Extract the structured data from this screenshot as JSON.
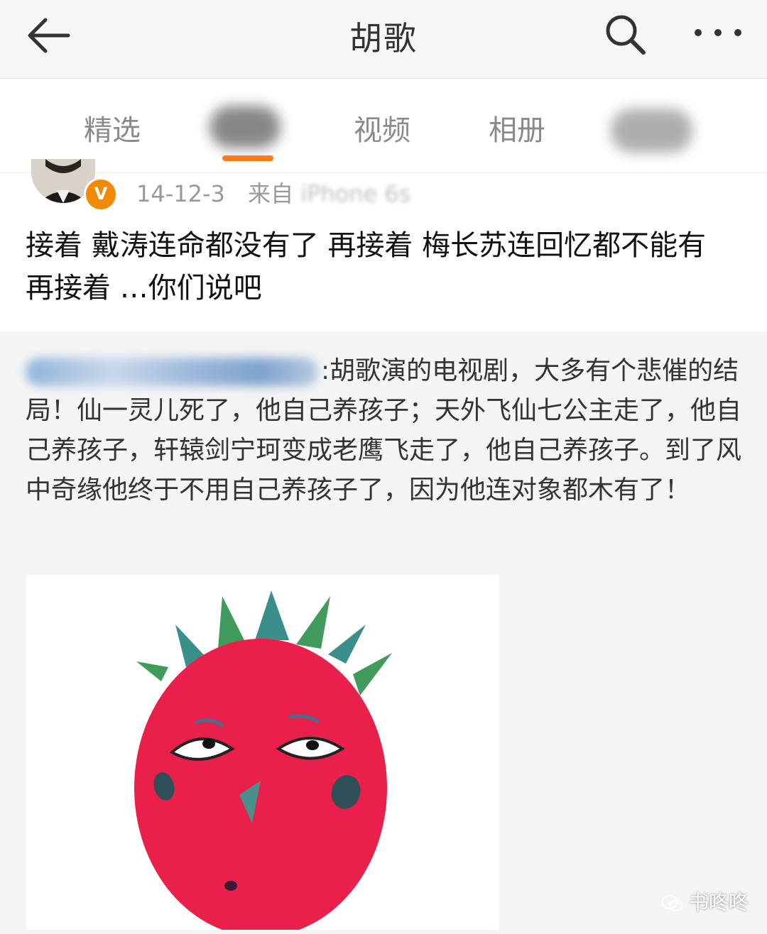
{
  "header": {
    "title": "胡歌",
    "back_icon": "back-arrow-icon",
    "search_icon": "search-icon",
    "more_icon": "more-icon"
  },
  "tabs": [
    {
      "label": "精选",
      "active": false
    },
    {
      "label": "",
      "active": true,
      "note": "blurred"
    },
    {
      "label": "视频",
      "active": false
    },
    {
      "label": "相册",
      "active": false
    },
    {
      "label": "",
      "active": false,
      "note": "blurred"
    }
  ],
  "post": {
    "date": "14-12-3",
    "source_prefix": "来自",
    "source_device": "iPhone 6s",
    "verified_badge": "V",
    "text": "接着 戴涛连命都没有了 再接着 梅长苏连回忆都不能有 再接着 …你们说吧"
  },
  "repost": {
    "text": ":胡歌演的电视剧，大多有个悲催的结局！仙一灵儿死了，他自己养孩子；天外飞仙七公主走了，他自己养孩子，轩辕剑宁珂变成老鹰飞走了，他自己养孩子。到了风中奇缘他终于不用自己养孩子了，因为他连对象都木有了！"
  },
  "watermark": "书咚咚",
  "colors": {
    "accent": "#ff7b1c",
    "badge": "#f08a00",
    "repost_bg": "#f5f5f5",
    "fruit_red": "#e8204a",
    "leaf_green": "#3f9a5c"
  }
}
